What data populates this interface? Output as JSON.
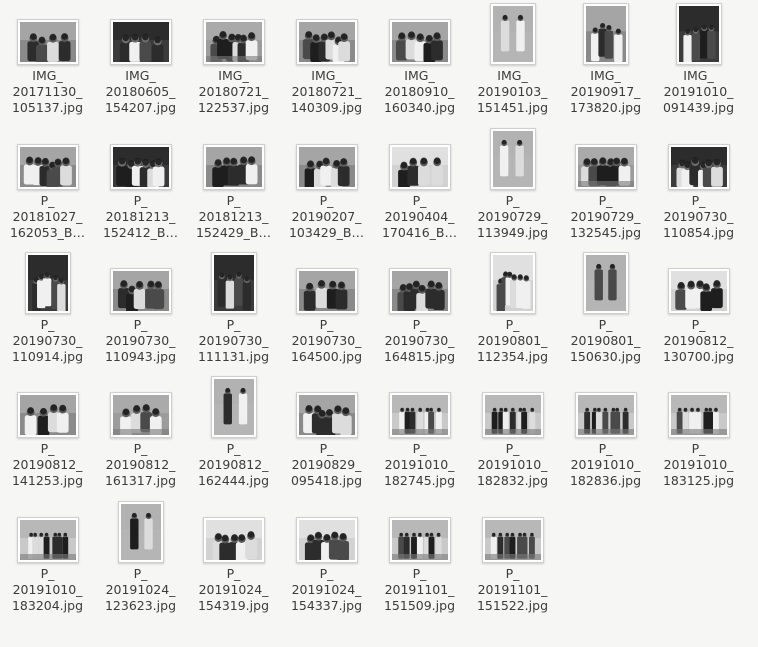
{
  "files": [
    {
      "l1": "IMG_",
      "l2": "20171130_",
      "l3": "105137.jpg",
      "orient": "land",
      "scene": "group"
    },
    {
      "l1": "IMG_",
      "l2": "20180605_",
      "l3": "154207.jpg",
      "orient": "land",
      "scene": "dark"
    },
    {
      "l1": "IMG_",
      "l2": "20180721_",
      "l3": "122537.jpg",
      "orient": "land",
      "scene": "outdoor"
    },
    {
      "l1": "IMG_",
      "l2": "20180721_",
      "l3": "140309.jpg",
      "orient": "land",
      "scene": "group"
    },
    {
      "l1": "IMG_",
      "l2": "20180910_",
      "l3": "160340.jpg",
      "orient": "land",
      "scene": "group"
    },
    {
      "l1": "IMG_",
      "l2": "20190103_",
      "l3": "151451.jpg",
      "orient": "port",
      "scene": "standing"
    },
    {
      "l1": "IMG_",
      "l2": "20190917_",
      "l3": "173820.jpg",
      "orient": "port",
      "scene": "group"
    },
    {
      "l1": "IMG_",
      "l2": "20191010_",
      "l3": "091439.jpg",
      "orient": "port",
      "scene": "dark"
    },
    {
      "l1": "P_",
      "l2": "20181027_",
      "l3": "162053_B…",
      "orient": "land",
      "scene": "group"
    },
    {
      "l1": "P_",
      "l2": "20181213_",
      "l3": "152412_B…",
      "orient": "land",
      "scene": "dark"
    },
    {
      "l1": "P_",
      "l2": "20181213_",
      "l3": "152429_B…",
      "orient": "land",
      "scene": "group"
    },
    {
      "l1": "P_",
      "l2": "20190207_",
      "l3": "103429_B…",
      "orient": "land",
      "scene": "group"
    },
    {
      "l1": "P_",
      "l2": "20190404_",
      "l3": "170416_B…",
      "orient": "land",
      "scene": "light"
    },
    {
      "l1": "P_",
      "l2": "20190729_",
      "l3": "113949.jpg",
      "orient": "port",
      "scene": "standing"
    },
    {
      "l1": "P_",
      "l2": "20190729_",
      "l3": "132545.jpg",
      "orient": "land",
      "scene": "outdoor"
    },
    {
      "l1": "P_",
      "l2": "20190730_",
      "l3": "110854.jpg",
      "orient": "land",
      "scene": "dark"
    },
    {
      "l1": "P_",
      "l2": "20190730_",
      "l3": "110914.jpg",
      "orient": "port",
      "scene": "dark"
    },
    {
      "l1": "P_",
      "l2": "20190730_",
      "l3": "110943.jpg",
      "orient": "land",
      "scene": "group"
    },
    {
      "l1": "P_",
      "l2": "20190730_",
      "l3": "111131.jpg",
      "orient": "port",
      "scene": "dark"
    },
    {
      "l1": "P_",
      "l2": "20190730_",
      "l3": "164500.jpg",
      "orient": "land",
      "scene": "group"
    },
    {
      "l1": "P_",
      "l2": "20190730_",
      "l3": "164815.jpg",
      "orient": "land",
      "scene": "group"
    },
    {
      "l1": "P_",
      "l2": "20190801_",
      "l3": "112354.jpg",
      "orient": "port",
      "scene": "light"
    },
    {
      "l1": "P_",
      "l2": "20190801_",
      "l3": "150630.jpg",
      "orient": "port",
      "scene": "standing"
    },
    {
      "l1": "P_",
      "l2": "20190812_",
      "l3": "130700.jpg",
      "orient": "land",
      "scene": "light"
    },
    {
      "l1": "P_",
      "l2": "20190812_",
      "l3": "141253.jpg",
      "orient": "land",
      "scene": "group"
    },
    {
      "l1": "P_",
      "l2": "20190812_",
      "l3": "161317.jpg",
      "orient": "land",
      "scene": "outdoor"
    },
    {
      "l1": "P_",
      "l2": "20190812_",
      "l3": "162444.jpg",
      "orient": "port",
      "scene": "standing"
    },
    {
      "l1": "P_",
      "l2": "20190829_",
      "l3": "095418.jpg",
      "orient": "land",
      "scene": "group"
    },
    {
      "l1": "P_",
      "l2": "20191010_",
      "l3": "182745.jpg",
      "orient": "land",
      "scene": "line"
    },
    {
      "l1": "P_",
      "l2": "20191010_",
      "l3": "182832.jpg",
      "orient": "land",
      "scene": "line"
    },
    {
      "l1": "P_",
      "l2": "20191010_",
      "l3": "182836.jpg",
      "orient": "land",
      "scene": "line"
    },
    {
      "l1": "P_",
      "l2": "20191010_",
      "l3": "183125.jpg",
      "orient": "land",
      "scene": "line"
    },
    {
      "l1": "P_",
      "l2": "20191010_",
      "l3": "183204.jpg",
      "orient": "land",
      "scene": "line"
    },
    {
      "l1": "P_",
      "l2": "20191024_",
      "l3": "123623.jpg",
      "orient": "port",
      "scene": "standing"
    },
    {
      "l1": "P_",
      "l2": "20191024_",
      "l3": "154319.jpg",
      "orient": "land",
      "scene": "light"
    },
    {
      "l1": "P_",
      "l2": "20191024_",
      "l3": "154337.jpg",
      "orient": "land",
      "scene": "light"
    },
    {
      "l1": "P_",
      "l2": "20191101_",
      "l3": "151509.jpg",
      "orient": "land",
      "scene": "line"
    },
    {
      "l1": "P_",
      "l2": "20191101_",
      "l3": "151522.jpg",
      "orient": "land",
      "scene": "line"
    }
  ]
}
